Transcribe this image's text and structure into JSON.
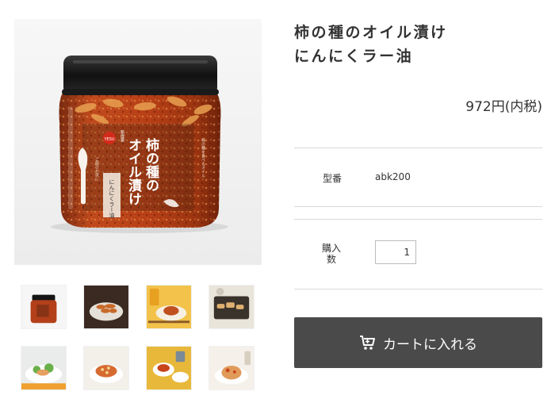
{
  "product": {
    "title_line1": "柿の種のオイル漬け",
    "title_line2": "にんにくラー油",
    "price": "972円(内税)"
  },
  "jar_label": {
    "brand": "YESU",
    "new": "新提案",
    "name_line1": "柿の種の",
    "name_line2": "オイル漬け",
    "flavor": "にんにくラー油",
    "side_note": "柿の種を食べるオイル",
    "spoon_note": "ご飯のお供に"
  },
  "spec": {
    "model_label": "型番",
    "model_value": "abk200",
    "qty_label_line1": "購入",
    "qty_label_line2": "数",
    "qty_value": "1"
  },
  "cart": {
    "button_label": "カートに入れる",
    "icon": "cart-icon"
  },
  "thumbnails": [
    {
      "name": "thumb-jar"
    },
    {
      "name": "thumb-dish-bowl"
    },
    {
      "name": "thumb-dish-plate-beer"
    },
    {
      "name": "thumb-dish-tray"
    },
    {
      "name": "thumb-dish-salad"
    },
    {
      "name": "thumb-dish-noodles"
    },
    {
      "name": "thumb-dish-set"
    },
    {
      "name": "thumb-dish-pasta"
    }
  ],
  "colors": {
    "accent": "#4a4a4a",
    "divider": "#d9d9d9",
    "text": "#333333"
  }
}
